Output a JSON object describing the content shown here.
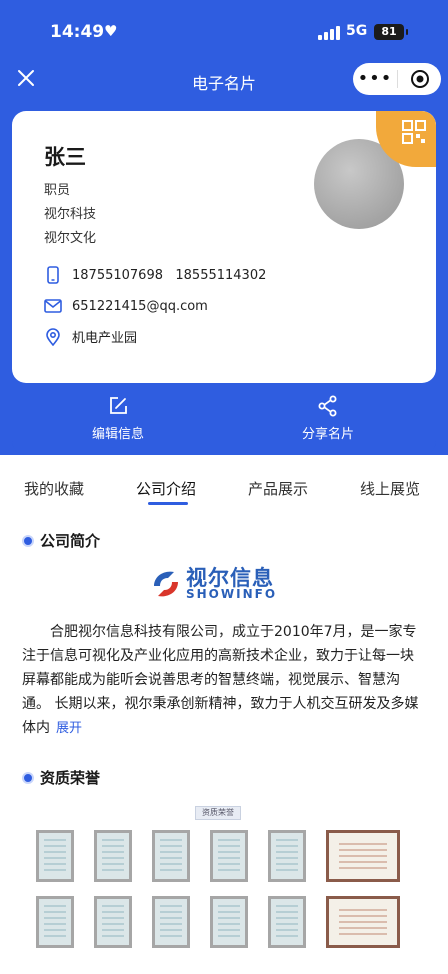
{
  "status_bar": {
    "time": "14:49",
    "network": "5G",
    "battery": "81"
  },
  "nav": {
    "title": "电子名片",
    "more_glyph": "•••"
  },
  "card": {
    "name": "张三",
    "role": "职员",
    "company1": "视尔科技",
    "company2": "视尔文化",
    "phones": "18755107698   18555114302",
    "email": "651221415@qq.com",
    "address": "机电产业园"
  },
  "actions": {
    "edit": "编辑信息",
    "share": "分享名片"
  },
  "tabs": [
    "我的收藏",
    "公司介绍",
    "产品展示",
    "线上展览"
  ],
  "active_tab": "公司介绍",
  "section_intro": {
    "title": "公司简介",
    "logo_cn": "视尔信息",
    "logo_en": "SHOWINFO",
    "text": "合肥视尔信息科技有限公司，成立于2010年7月，是一家专注于信息可视化及产业化应用的高新技术企业，致力于让每一块屏幕都能成为能听会说善思考的智慧终端，视觉展示、智慧沟通。 长期以来，视尔秉承创新精神，致力于人机交互研发及多媒体内",
    "expand": "展开"
  },
  "section_honor": {
    "title": "资质荣誉",
    "image_label": "资质荣誉"
  },
  "colors": {
    "primary": "#2f5de0",
    "accent": "#f2a93b"
  },
  "icons": [
    "close-icon",
    "more-icon",
    "target-icon",
    "qr-code-icon",
    "phone-icon",
    "mail-icon",
    "location-icon",
    "edit-icon",
    "share-icon"
  ]
}
